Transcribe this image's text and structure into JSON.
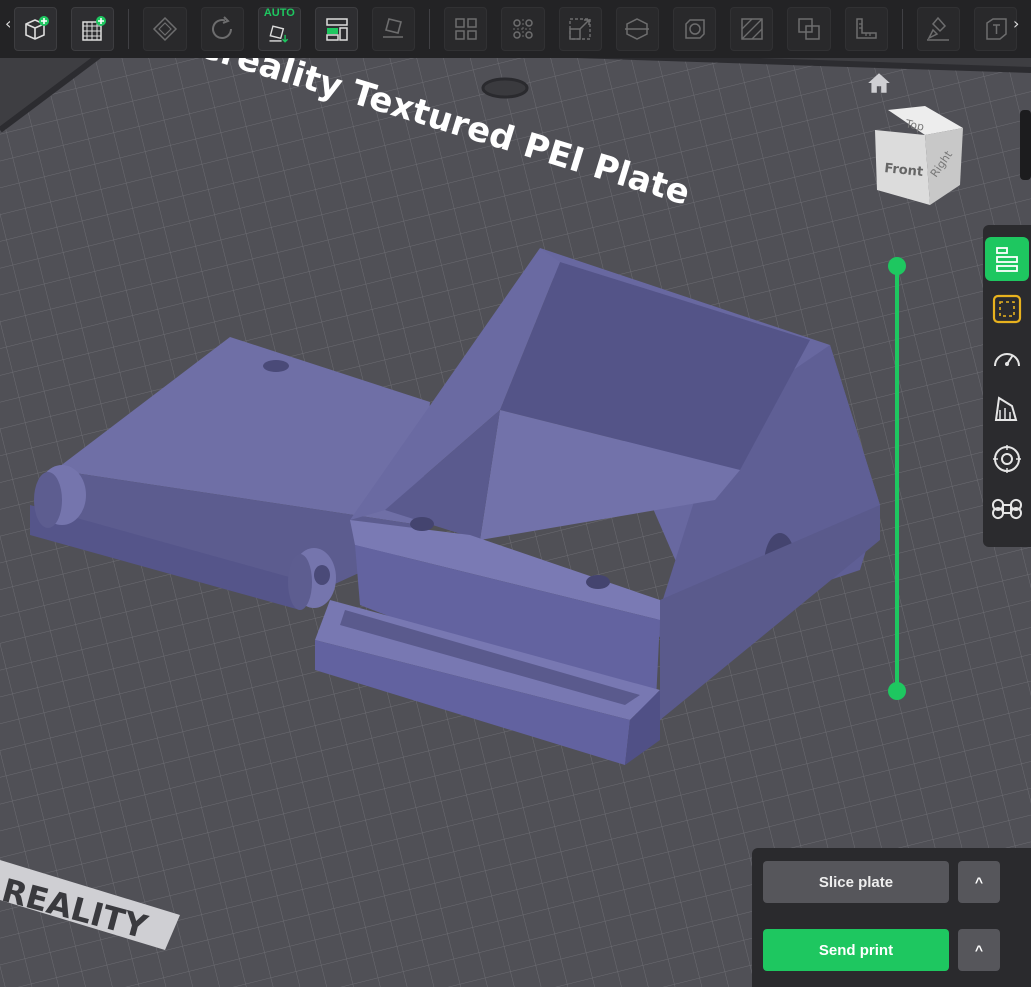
{
  "viewport": {
    "plate_label": "Creality Textured PEI Plate",
    "brand_watermark": "REALITY",
    "view_cube": {
      "top": "Top",
      "front": "Front",
      "right": "Right"
    }
  },
  "toolbar": {
    "auto_label": "AUTO",
    "left_arrow": "‹",
    "right_arrow": "›"
  },
  "actions": {
    "slice_label": "Slice plate",
    "send_label": "Send print",
    "caret": "^"
  },
  "colors": {
    "accent": "#1ec760",
    "model": "#6f6fa6",
    "plate": "#505055"
  }
}
